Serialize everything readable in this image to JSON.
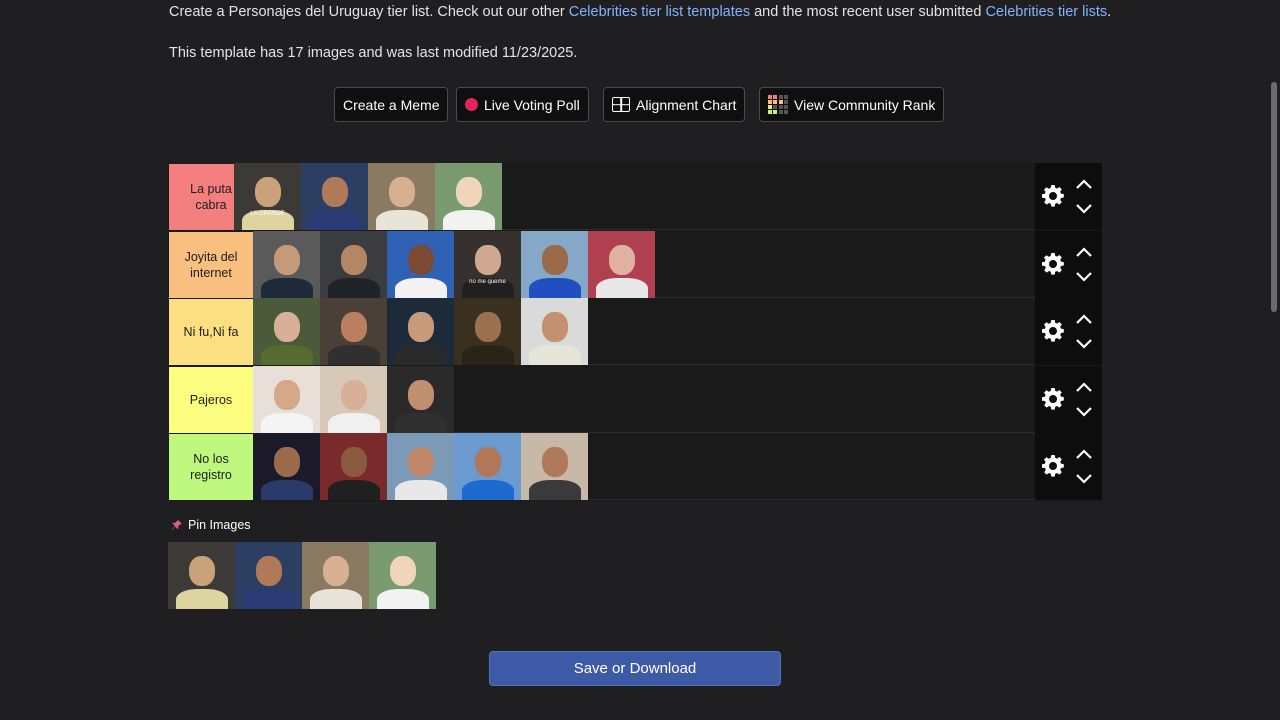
{
  "intro": {
    "prefix": "Create a Personajes del Uruguay tier list. Check out our other ",
    "link1": "Celebrities tier list templates",
    "middle": " and the most recent user submitted ",
    "link2": "Celebrities tier lists",
    "suffix": "."
  },
  "meta": "This template has 17 images and was last modified 11/23/2025.",
  "buttons": {
    "meme": "Create a Meme",
    "poll": "Live Voting Poll",
    "alignment": "Alignment Chart",
    "community": "View Community Rank"
  },
  "colors": {
    "poll_dot": "#e0245e",
    "save": "#3c5aa6",
    "link": "#82b4ff"
  },
  "tiers": [
    {
      "label": "La puta cabra",
      "color": "#f47f7f",
      "items": 4
    },
    {
      "label": "Joyita del internet",
      "color": "#f8bf7f",
      "items": 6
    },
    {
      "label": "Ni fu,Ni fa",
      "color": "#fcdf80",
      "items": 5
    },
    {
      "label": "Pajeros",
      "color": "#fdfe7f",
      "items": 3
    },
    {
      "label": "No los registro",
      "color": "#bef87f",
      "items": 5
    }
  ],
  "thumb_captions": {
    "tier0_item0": "LA GRANDE",
    "tier1_item3": "no me queme"
  },
  "pin": {
    "label": "Pin Images",
    "items": 4
  },
  "save_label": "Save or Download"
}
